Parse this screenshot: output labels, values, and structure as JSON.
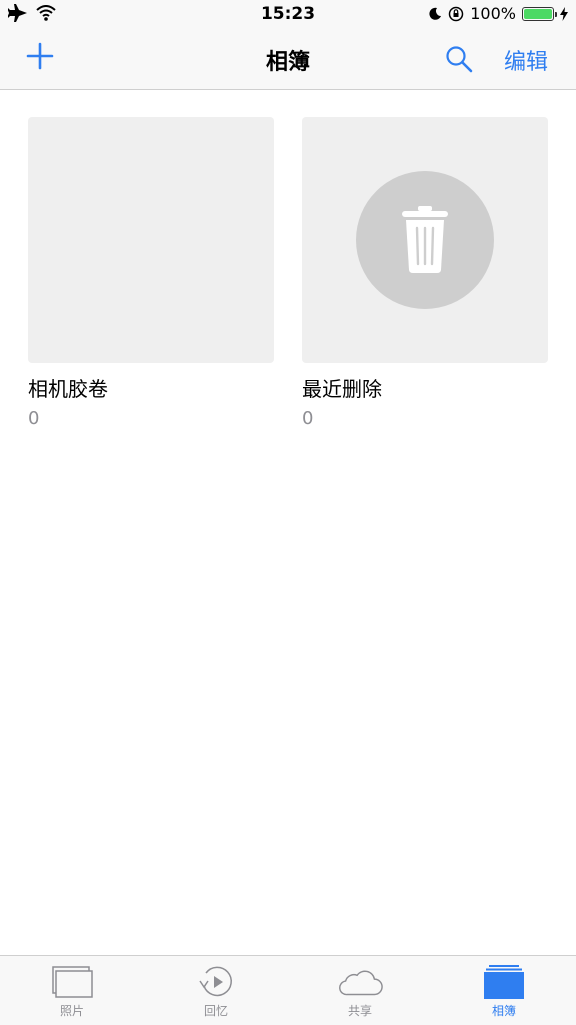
{
  "status_bar": {
    "time": "15:23",
    "battery_text": "100%"
  },
  "nav": {
    "title": "相簿",
    "edit_label": "编辑"
  },
  "albums": [
    {
      "name": "相机胶卷",
      "count": "0"
    },
    {
      "name": "最近删除",
      "count": "0"
    }
  ],
  "tabs": [
    {
      "label": "照片"
    },
    {
      "label": "回忆"
    },
    {
      "label": "共享"
    },
    {
      "label": "相簿"
    }
  ],
  "colors": {
    "accent": "#2f7ef0",
    "battery_green": "#4cd964"
  },
  "icons": {
    "airplane": "airplane-icon",
    "wifi": "wifi-icon",
    "moon": "moon-icon",
    "orientation_lock": "orientation-lock-icon",
    "charging": "charging-icon",
    "add": "add-icon",
    "search": "search-icon",
    "trash": "trash-icon"
  }
}
